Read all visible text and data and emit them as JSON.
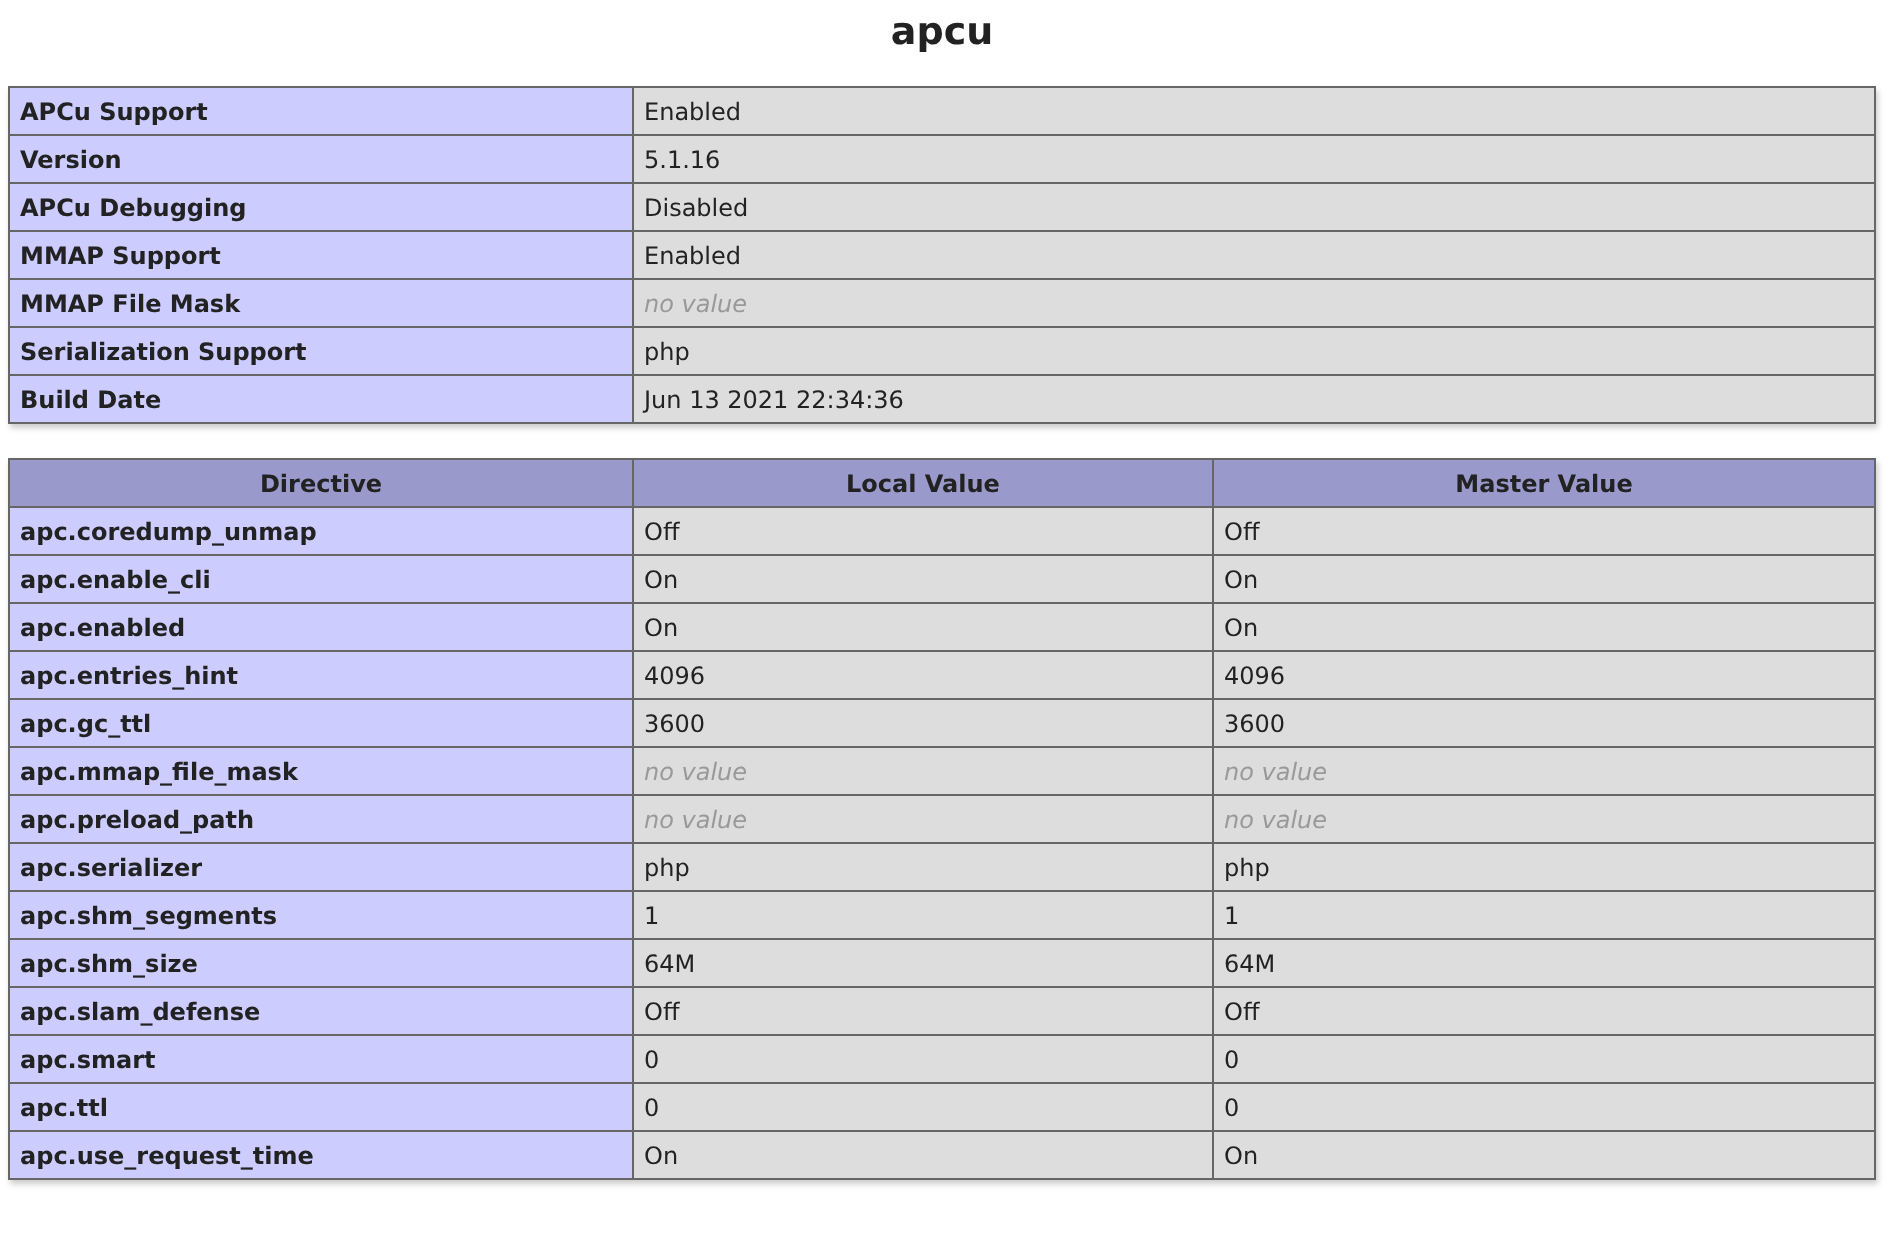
{
  "title": "apcu",
  "info": [
    {
      "label": "APCu Support",
      "value": "Enabled",
      "kind": "text"
    },
    {
      "label": "Version",
      "value": "5.1.16",
      "kind": "text"
    },
    {
      "label": "APCu Debugging",
      "value": "Disabled",
      "kind": "text"
    },
    {
      "label": "MMAP Support",
      "value": "Enabled",
      "kind": "text"
    },
    {
      "label": "MMAP File Mask",
      "value": "no value",
      "kind": "novalue"
    },
    {
      "label": "Serialization Support",
      "value": "php",
      "kind": "text"
    },
    {
      "label": "Build Date",
      "value": "Jun 13 2021 22:34:36",
      "kind": "text"
    }
  ],
  "directives": {
    "columns": [
      "Directive",
      "Local Value",
      "Master Value"
    ],
    "rows": [
      {
        "name": "apc.coredump_unmap",
        "local": "Off",
        "master": "Off",
        "kind": "text"
      },
      {
        "name": "apc.enable_cli",
        "local": "On",
        "master": "On",
        "kind": "text"
      },
      {
        "name": "apc.enabled",
        "local": "On",
        "master": "On",
        "kind": "text"
      },
      {
        "name": "apc.entries_hint",
        "local": "4096",
        "master": "4096",
        "kind": "text"
      },
      {
        "name": "apc.gc_ttl",
        "local": "3600",
        "master": "3600",
        "kind": "text"
      },
      {
        "name": "apc.mmap_file_mask",
        "local": "no value",
        "master": "no value",
        "kind": "novalue"
      },
      {
        "name": "apc.preload_path",
        "local": "no value",
        "master": "no value",
        "kind": "novalue"
      },
      {
        "name": "apc.serializer",
        "local": "php",
        "master": "php",
        "kind": "text"
      },
      {
        "name": "apc.shm_segments",
        "local": "1",
        "master": "1",
        "kind": "text"
      },
      {
        "name": "apc.shm_size",
        "local": "64M",
        "master": "64M",
        "kind": "text"
      },
      {
        "name": "apc.slam_defense",
        "local": "Off",
        "master": "Off",
        "kind": "text"
      },
      {
        "name": "apc.smart",
        "local": "0",
        "master": "0",
        "kind": "text"
      },
      {
        "name": "apc.ttl",
        "local": "0",
        "master": "0",
        "kind": "text"
      },
      {
        "name": "apc.use_request_time",
        "local": "On",
        "master": "On",
        "kind": "text"
      }
    ]
  }
}
